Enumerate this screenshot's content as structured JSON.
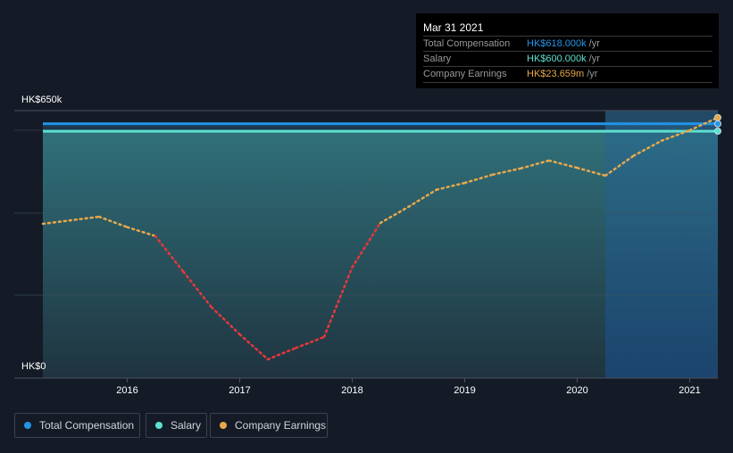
{
  "tooltip": {
    "date": "Mar 31 2021",
    "rows": [
      {
        "label": "Total Compensation",
        "value": "HK$618.000k",
        "unit": "/yr"
      },
      {
        "label": "Salary",
        "value": "HK$600.000k",
        "unit": "/yr"
      },
      {
        "label": "Company Earnings",
        "value": "HK$23.659m",
        "unit": "/yr"
      }
    ]
  },
  "legend": [
    {
      "label": "Total Compensation",
      "color": "#2394e8"
    },
    {
      "label": "Salary",
      "color": "#5ce0d0"
    },
    {
      "label": "Company Earnings",
      "color": "#e8a84a"
    }
  ],
  "chart_data": {
    "type": "line",
    "y_top_label": "HK$650k",
    "y_bottom_label": "HK$0",
    "ylim": [
      0,
      650000
    ],
    "xlim": [
      2015.25,
      2021.25
    ],
    "x_ticks": [
      "2016",
      "2017",
      "2018",
      "2019",
      "2020",
      "2021"
    ],
    "highlight_from": 2020.25,
    "series": [
      {
        "name": "Total Compensation",
        "unit": "HK$",
        "color": "#2394e8",
        "x": [
          2015.25,
          2021.25
        ],
        "values": [
          618000,
          618000
        ]
      },
      {
        "name": "Salary",
        "unit": "HK$",
        "color": "#5ce0d0",
        "x": [
          2015.25,
          2021.25
        ],
        "values": [
          600000,
          600000
        ]
      },
      {
        "name": "Company Earnings",
        "unit": "HK$m",
        "color": "#e8a84a",
        "negative_color": "#e5383b",
        "ylim": [
          -26.4,
          25.0
        ],
        "x": [
          2015.25,
          2015.75,
          2016.0,
          2016.25,
          2016.5,
          2016.75,
          2017.0,
          2017.25,
          2017.5,
          2017.75,
          2018.0,
          2018.25,
          2018.5,
          2018.75,
          2019.0,
          2019.25,
          2019.5,
          2019.75,
          2020.0,
          2020.25,
          2020.5,
          2020.75,
          2021.0,
          2021.25
        ],
        "values": [
          3.25,
          4.6,
          2.6,
          0.9,
          -6.0,
          -12.8,
          -18.0,
          -22.8,
          -20.6,
          -18.5,
          -5.1,
          3.4,
          6.5,
          9.8,
          11.1,
          12.7,
          13.9,
          15.4,
          14.0,
          12.5,
          16.3,
          19.2,
          21.2,
          23.659
        ]
      }
    ]
  }
}
